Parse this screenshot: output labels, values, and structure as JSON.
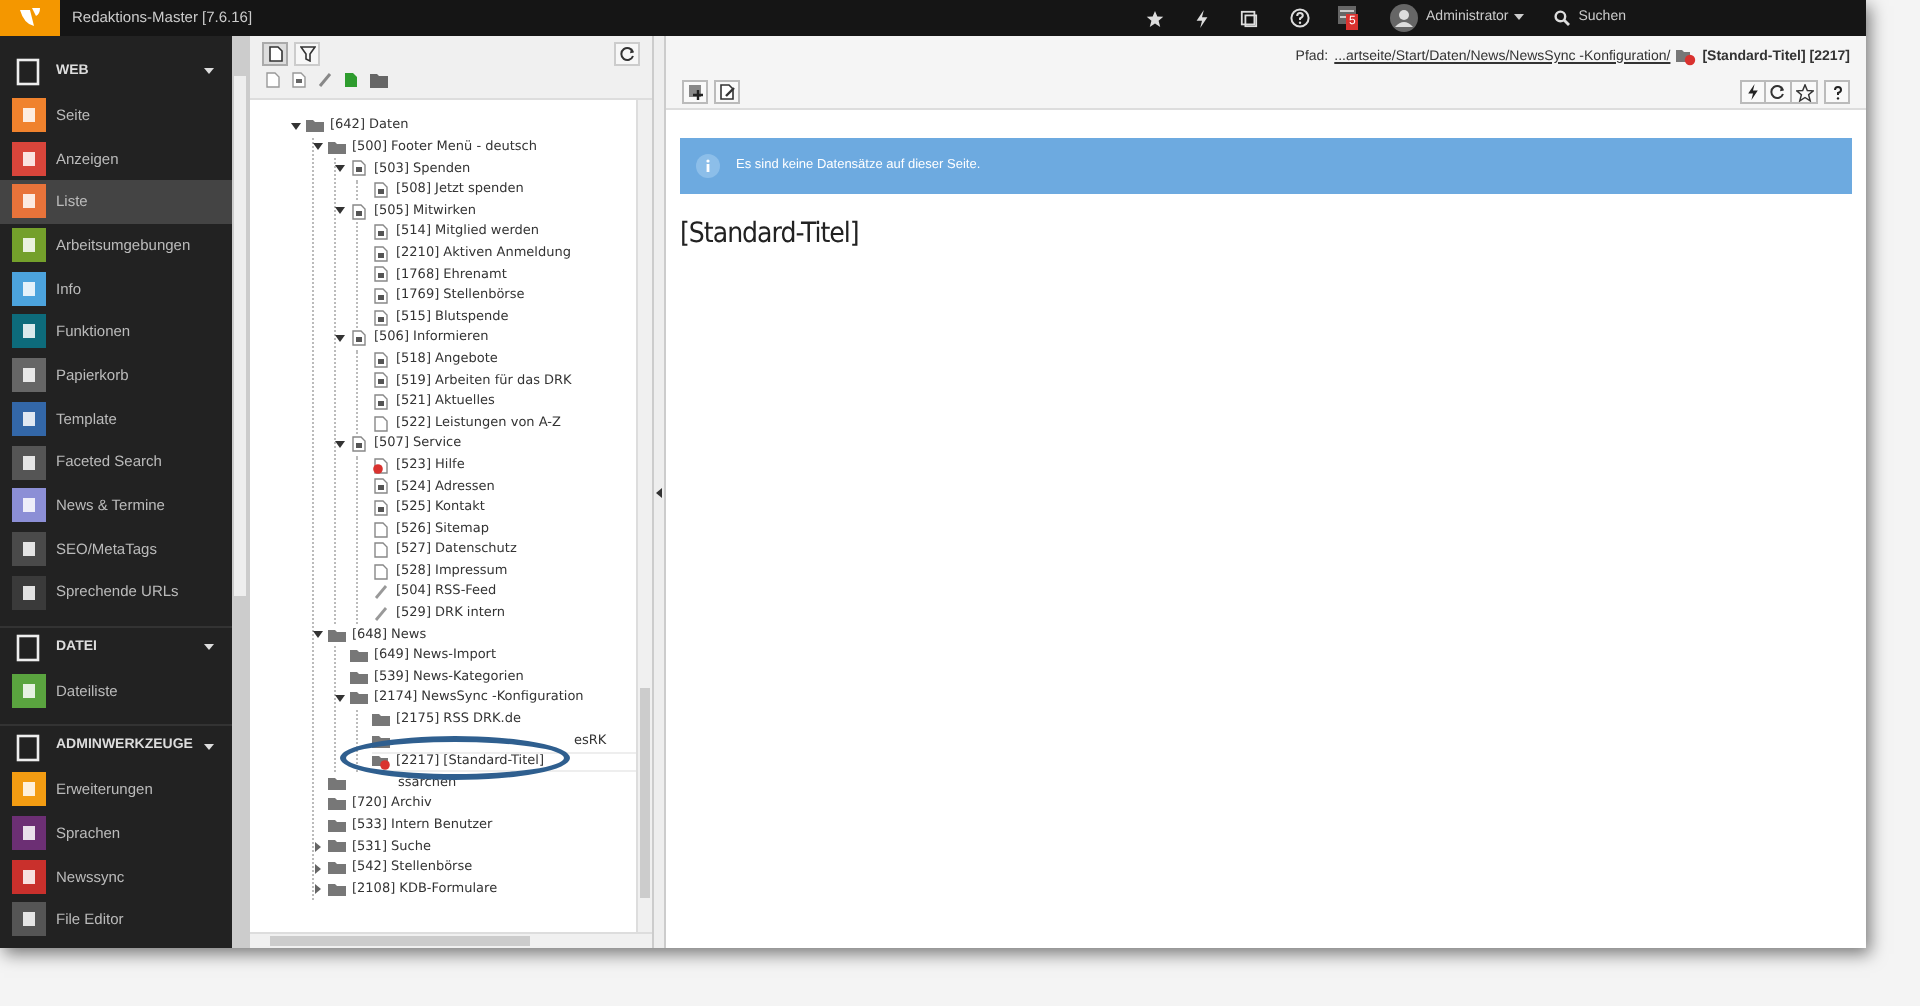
{
  "topbar": {
    "title": "Redaktions-Master [7.6.16]",
    "notification_count": "5",
    "user": "Administrator",
    "search": "Suchen"
  },
  "sidebar": {
    "groups": [
      {
        "label": "WEB",
        "expanded": true,
        "items": [
          {
            "label": "Seite",
            "color": "#f0822d",
            "selected": false
          },
          {
            "label": "Anzeigen",
            "color": "#d9453b",
            "selected": false
          },
          {
            "label": "Liste",
            "color": "#e8733a",
            "selected": true
          },
          {
            "label": "Arbeitsumgebungen",
            "color": "#74a02b",
            "selected": false
          },
          {
            "label": "Info",
            "color": "#4ca3dd",
            "selected": false
          },
          {
            "label": "Funktionen",
            "color": "#0d6b7b",
            "selected": false
          },
          {
            "label": "Papierkorb",
            "color": "#666666",
            "selected": false
          },
          {
            "label": "Template",
            "color": "#3367a8",
            "selected": false
          },
          {
            "label": "Faceted Search",
            "color": "#555555",
            "selected": false
          },
          {
            "label": "News & Termine",
            "color": "#8c8fd6",
            "selected": false
          },
          {
            "label": "SEO/MetaTags",
            "color": "#4a4a4a",
            "selected": false
          },
          {
            "label": "Sprechende URLs",
            "color": "#3a3a3a",
            "selected": false
          }
        ]
      },
      {
        "label": "DATEI",
        "expanded": true,
        "items": [
          {
            "label": "Dateiliste",
            "color": "#5aa43f",
            "selected": false
          }
        ]
      },
      {
        "label": "ADMINWERKZEUGE",
        "expanded": true,
        "items": [
          {
            "label": "Erweiterungen",
            "color": "#f39c12",
            "selected": false
          },
          {
            "label": "Sprachen",
            "color": "#6c2f74",
            "selected": false
          },
          {
            "label": "Newssync",
            "color": "#c9302c",
            "selected": false
          },
          {
            "label": "File Editor",
            "color": "#555555",
            "selected": false
          }
        ]
      }
    ]
  },
  "tree": [
    {
      "label": "[642] Daten",
      "kind": "folder",
      "expanded": true,
      "selected": false,
      "children": [
        {
          "label": "[500] Footer Menü - deutsch",
          "kind": "folder",
          "expanded": true,
          "selected": false,
          "children": [
            {
              "label": "[503] Spenden",
              "kind": "page",
              "expanded": true,
              "selected": false,
              "children": [
                {
                  "label": "[508] Jetzt spenden",
                  "kind": "page",
                  "selected": false
                }
              ]
            },
            {
              "label": "[505] Mitwirken",
              "kind": "page",
              "expanded": true,
              "selected": false,
              "children": [
                {
                  "label": "[514] Mitglied werden",
                  "kind": "page",
                  "selected": false
                },
                {
                  "label": "[2210] Aktiven Anmeldung",
                  "kind": "page",
                  "selected": false
                },
                {
                  "label": "[1768] Ehrenamt",
                  "kind": "page",
                  "selected": false
                },
                {
                  "label": "[1769] Stellenbörse",
                  "kind": "page",
                  "selected": false
                },
                {
                  "label": "[515] Blutspende",
                  "kind": "page",
                  "selected": false
                }
              ]
            },
            {
              "label": "[506] Informieren",
              "kind": "page",
              "expanded": true,
              "selected": false,
              "children": [
                {
                  "label": "[518] Angebote",
                  "kind": "page",
                  "selected": false
                },
                {
                  "label": "[519] Arbeiten für das DRK",
                  "kind": "page",
                  "selected": false
                },
                {
                  "label": "[521] Aktuelles",
                  "kind": "page",
                  "selected": false
                },
                {
                  "label": "[522] Leistungen von A-Z",
                  "kind": "plain-page",
                  "selected": false
                }
              ]
            },
            {
              "label": "[507] Service",
              "kind": "page",
              "expanded": true,
              "selected": false,
              "children": [
                {
                  "label": "[523] Hilfe",
                  "kind": "restricted-page",
                  "selected": false
                },
                {
                  "label": "[524] Adressen",
                  "kind": "page",
                  "selected": false
                },
                {
                  "label": "[525] Kontakt",
                  "kind": "page",
                  "selected": false
                },
                {
                  "label": "[526] Sitemap",
                  "kind": "plain-page",
                  "selected": false
                },
                {
                  "label": "[527] Datenschutz",
                  "kind": "plain-page",
                  "selected": false
                },
                {
                  "label": "[528] Impressum",
                  "kind": "plain-page",
                  "selected": false
                },
                {
                  "label": "[504] RSS-Feed",
                  "kind": "link",
                  "selected": false
                },
                {
                  "label": "[529] DRK intern",
                  "kind": "link",
                  "selected": false
                }
              ]
            }
          ]
        },
        {
          "label": "[648] News",
          "kind": "folder",
          "expanded": true,
          "selected": false,
          "children": [
            {
              "label": "[649] News-Import",
              "kind": "folder",
              "selected": false
            },
            {
              "label": "[539] News-Kategorien",
              "kind": "folder",
              "selected": false
            },
            {
              "label": "[2174] NewsSync -Konfiguration",
              "kind": "folder",
              "expanded": true,
              "selected": false,
              "children": [
                {
                  "label": "[2175] RSS DRK.de",
                  "kind": "folder",
                  "selected": false
                },
                {
                  "label": "esRK",
                  "kind": "occluded",
                  "selected": false
                },
                {
                  "label": "[2217] [Standard-Titel]",
                  "kind": "restricted-folder",
                  "selected": true
                }
              ]
            }
          ]
        },
        {
          "label": "ssarchen",
          "kind": "occluded",
          "selected": false
        },
        {
          "label": "[720] Archiv",
          "kind": "folder",
          "selected": false
        },
        {
          "label": "[533] Intern Benutzer",
          "kind": "folder",
          "selected": false
        },
        {
          "label": "[531] Suche",
          "kind": "folder",
          "expanded": false,
          "selected": false
        },
        {
          "label": "[542] Stellenbörse",
          "kind": "folder",
          "expanded": false,
          "selected": false
        },
        {
          "label": "[2108] KDB-Formulare",
          "kind": "folder",
          "expanded": false,
          "selected": false
        }
      ]
    }
  ],
  "content": {
    "path_label": "Pfad:",
    "path": "...artseite/Start/Daten/News/NewsSync -Konfiguration/",
    "page_title": "[Standard-Titel] [2217]",
    "info": "Es sind keine Datensätze auf dieser Seite.",
    "heading": "[Standard-Titel]"
  }
}
